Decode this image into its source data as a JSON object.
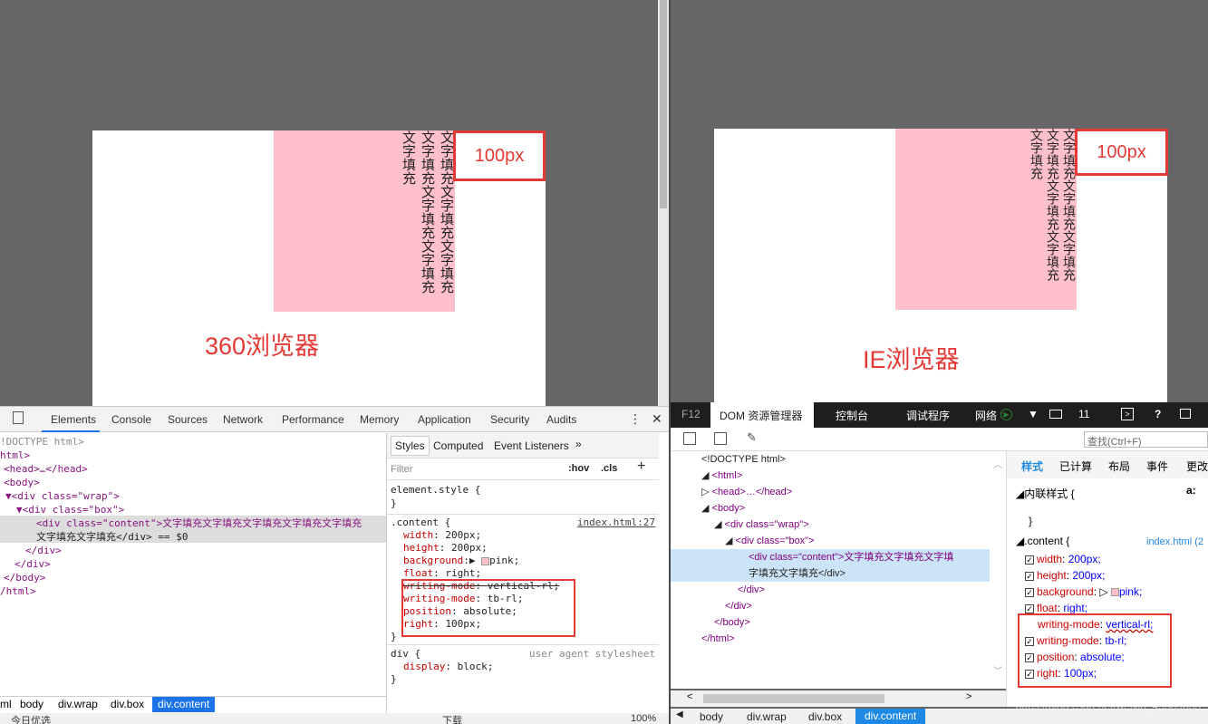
{
  "left_browser": {
    "label": "360浏览器",
    "box_label": "100px",
    "vertical_text_cols": [
      "文字填充",
      "文字填充文字填充文字填充",
      "文字填充文字填充文字填充"
    ],
    "devtools": {
      "tabs": [
        "Elements",
        "Console",
        "Sources",
        "Network",
        "Performance",
        "Memory",
        "Application",
        "Security",
        "Audits"
      ],
      "active_tab": "Elements",
      "close_label": "✕",
      "more_label": "⋮",
      "dom_lines": [
        "!DOCTYPE html>",
        "html>",
        "<head>…</head>",
        "<body>",
        "▼<div class=\"wrap\">",
        "▼<div class=\"box\">",
        "<div class=\"content\">文字填充文字填充文字填充文字填充文字填充",
        "文字填充文字填充</div> == $0",
        "</div>",
        "</div>",
        "</body>",
        "/html>"
      ],
      "styles_tabs": [
        "Styles",
        "Computed",
        "Event Listeners",
        "»"
      ],
      "filter_placeholder": "Filter",
      "hov_label": ":hov",
      "cls_label": ".cls",
      "plus_label": "+",
      "element_style": "element.style {",
      "close_brace": "}",
      "rule_selector": ".content {",
      "rule_source": "index.html:27",
      "rule_props": [
        {
          "name": "width",
          "value": "200px;"
        },
        {
          "name": "height",
          "value": "200px;"
        },
        {
          "name": "background",
          "value": "pink;"
        },
        {
          "name": "float",
          "value": "right;"
        },
        {
          "name": "writing-mode",
          "value": "vertical-rl;"
        },
        {
          "name": "writing-mode",
          "value": "tb-rl;"
        },
        {
          "name": "position",
          "value": "absolute;"
        },
        {
          "name": "right",
          "value": "100px;"
        }
      ],
      "ua_selector": "div {",
      "ua_source": "user agent stylesheet",
      "ua_prop": {
        "name": "display",
        "value": "block;"
      },
      "breadcrumbs": [
        "ml",
        "body",
        "div.wrap",
        "div.box",
        "div.content"
      ],
      "status_text": "今日优选",
      "status_right": [
        "下载",
        "100%"
      ]
    }
  },
  "right_browser": {
    "label": "IE浏览器",
    "box_label": "100px",
    "vertical_text_cols": [
      "文字填充",
      "文字填充文字填充文字填充",
      "文字填充文字填充文字填充"
    ],
    "devtools": {
      "f12": "F12",
      "tabs": [
        "DOM 资源管理器",
        "控制台",
        "调试程序",
        "网络"
      ],
      "active_tab": "DOM 资源管理器",
      "emulation_count": "11",
      "help_label": "?",
      "search_placeholder": "查找(Ctrl+F)",
      "dom_lines": [
        "<!DOCTYPE html>",
        "<html>",
        "<head>…</head>",
        "<body>",
        "<div class=\"wrap\">",
        "<div class=\"box\">",
        "<div class=\"content\">文字填充文字填充文字填",
        "字填充文字填充</div>",
        "</div>",
        "</div>",
        "</body>",
        "</html>"
      ],
      "styles_tabs": [
        "样式",
        "已计算",
        "布局",
        "事件",
        "更改"
      ],
      "aa_label": "a:",
      "inline_style": "内联样式  {",
      "close_brace": "}",
      "rule_selector": ".content  {",
      "rule_source": "index.html (2",
      "rule_props": [
        {
          "name": "width",
          "value": "200px;"
        },
        {
          "name": "height",
          "value": "200px;"
        },
        {
          "name": "background",
          "value": "pink;"
        },
        {
          "name": "float",
          "value": "right;"
        },
        {
          "name": "writing-mode",
          "value": "vertical-rl;"
        },
        {
          "name": "writing-mode",
          "value": "tb-rl;"
        },
        {
          "name": "position",
          "value": "absolute;"
        },
        {
          "name": "right",
          "value": "100px;"
        }
      ],
      "breadcrumbs": [
        "body",
        "div.wrap",
        "div.box",
        "div.content"
      ]
    }
  },
  "watermark": "https://blog.csdn.net/weixin_45389633"
}
